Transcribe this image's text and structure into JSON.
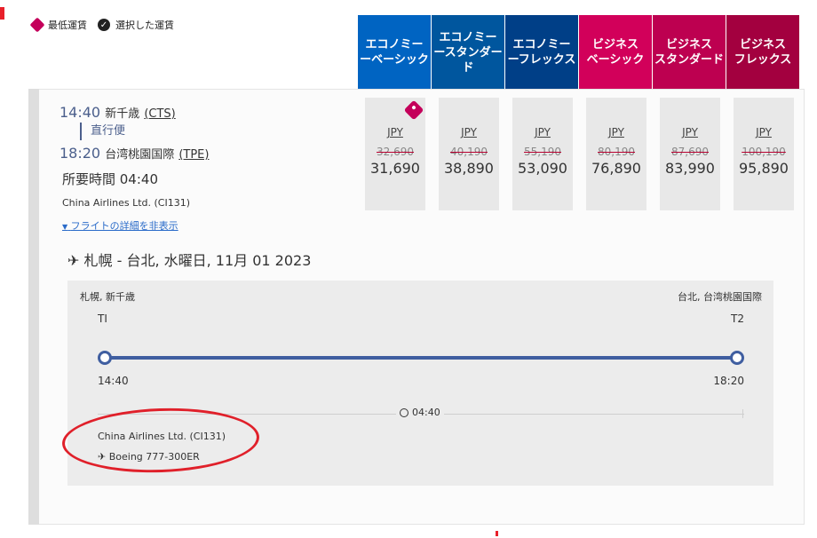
{
  "legend": {
    "lowest_fare": "最低運賃",
    "selected_fare": "選択した運賃"
  },
  "fare_headers": [
    "エコノミー\nーベーシック",
    "エコノミー\nースタンダード",
    "エコノミー\nーフレックス",
    "ビジネス\nベーシック",
    "ビジネス\nスタンダード",
    "ビジネス\nフレックス"
  ],
  "flight": {
    "dep_time": "14:40",
    "dep_airport": "新千歳",
    "dep_code": "(CTS)",
    "direct": "直行便",
    "arr_time": "18:20",
    "arr_airport": "台湾桃園国際",
    "arr_code": "(TPE)",
    "duration": "所要時間 04:40",
    "airline": "China Airlines Ltd. (CI131)",
    "details_link": "フライトの詳細を非表示"
  },
  "prices": [
    {
      "currency": "JPY",
      "old": "32,690",
      "new": "31,690"
    },
    {
      "currency": "JPY",
      "old": "40,190",
      "new": "38,890"
    },
    {
      "currency": "JPY",
      "old": "55,190",
      "new": "53,090"
    },
    {
      "currency": "JPY",
      "old": "80,190",
      "new": "76,890"
    },
    {
      "currency": "JPY",
      "old": "87,690",
      "new": "83,990"
    },
    {
      "currency": "JPY",
      "old": "100,190",
      "new": "95,890"
    }
  ],
  "details": {
    "route_title": "札幌 - 台北, 水曜日, 11月 01 2023",
    "from_city": "札幌, 新千歳",
    "to_city": "台北, 台湾桃園国際",
    "from_terminal": "TI",
    "to_terminal": "T2",
    "dep_time": "14:40",
    "arr_time": "18:20",
    "duration": "04:40",
    "airline": "China Airlines Ltd. (CI131)",
    "aircraft": "Boeing 777-300ER"
  }
}
